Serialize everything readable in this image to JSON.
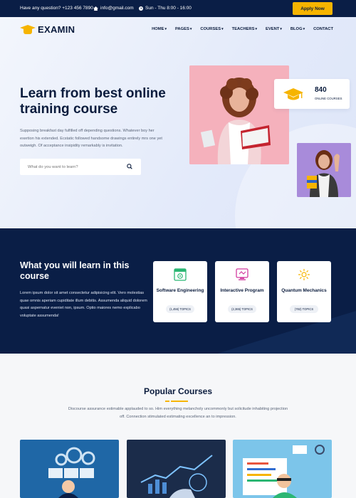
{
  "topbar": {
    "phone": "Have any question? +123 456 7890",
    "email": "info@gmail.com",
    "hours": "Sun - Thu  8:00 - 16:00",
    "apply_label": "Apply Now"
  },
  "brand": {
    "name": "EXAMIN"
  },
  "nav": {
    "items": [
      "HOME",
      "PAGES",
      "COURSES",
      "TEACHERS",
      "EVENT",
      "BLOG",
      "CONTACT"
    ]
  },
  "hero": {
    "title": "Learn from best online training course",
    "description": "Supposing breakfast day fulfilled off depending questions. Whatever boy her exertion his extended. Ecstatic followed handsome drawings entirely mrs one yet outweigh. Of acceptance insipidity remarkably is invitation.",
    "search_placeholder": "What do you want to learn?",
    "stat_number": "840",
    "stat_label": "ONLINE COURSES"
  },
  "learn": {
    "title": "What you will learn in this course",
    "description": "Lorem ipsum dolor sit amet consectetur adipisicing elit. Vero molestias quae omnis aperiam cupiditate illum debitis. Assumenda aliquid dolorem quasi aspernatur eveniet non, ipsum. Optio maiores nemo explicabo voluptate assumenda!",
    "categories": [
      {
        "name": "Software Engineering",
        "topics": "(1,456) TOPICS",
        "icon": "software-icon",
        "color": "#2bb673"
      },
      {
        "name": "Interactive Program",
        "topics": "(2,365) TOPICS",
        "icon": "interactive-icon",
        "color": "#d23ba0"
      },
      {
        "name": "Quantum Mechanics",
        "topics": "(782) TOPICS",
        "icon": "quantum-icon",
        "color": "#f6b400"
      }
    ]
  },
  "popular": {
    "title": "Popular Courses",
    "description": "Discourse assurance estimable applauded to so. Him everything melancholy uncommonly but solicitude inhabiting projection off. Connection stimulated estimating excellence an to impression."
  },
  "colors": {
    "navy": "#0a1e46",
    "accent": "#f6b400"
  }
}
